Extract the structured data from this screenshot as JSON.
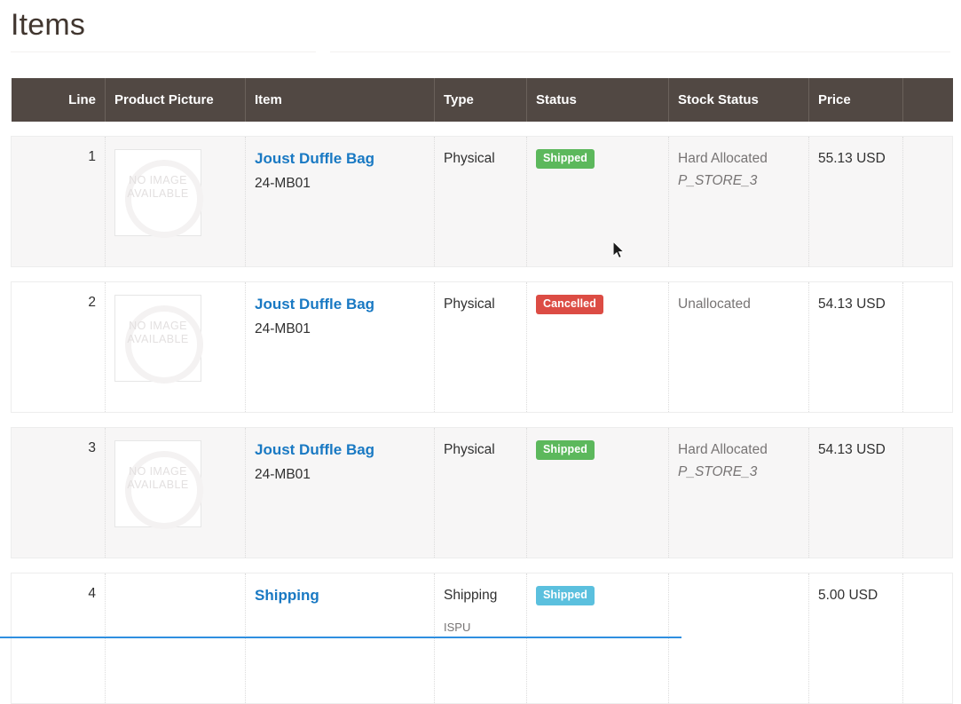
{
  "page": {
    "title": "Items"
  },
  "table": {
    "columns": [
      {
        "key": "line",
        "label": "Line"
      },
      {
        "key": "pic",
        "label": "Product Picture"
      },
      {
        "key": "item",
        "label": "Item"
      },
      {
        "key": "type",
        "label": "Type"
      },
      {
        "key": "status",
        "label": "Status"
      },
      {
        "key": "stock",
        "label": "Stock Status"
      },
      {
        "key": "price",
        "label": "Price"
      },
      {
        "key": "extra",
        "label": ""
      }
    ],
    "placeholder_image_text_line1": "NO IMAGE",
    "placeholder_image_text_line2": "AVAILABLE",
    "rows": [
      {
        "line": "1",
        "has_image": true,
        "item_name": "Joust Duffle Bag",
        "item_sku": "24-MB01",
        "type": "Physical",
        "type_sub": "",
        "status": "Shipped",
        "status_color": "#5cb85c",
        "status_variant": "success",
        "stock": "Hard Allocated",
        "stock_source": "P_STORE_3",
        "price": "55.13 USD"
      },
      {
        "line": "2",
        "has_image": true,
        "item_name": "Joust Duffle Bag",
        "item_sku": "24-MB01",
        "type": "Physical",
        "type_sub": "",
        "status": "Cancelled",
        "status_color": "#dc4c44",
        "status_variant": "danger",
        "stock": "Unallocated",
        "stock_source": "",
        "price": "54.13 USD"
      },
      {
        "line": "3",
        "has_image": true,
        "item_name": "Joust Duffle Bag",
        "item_sku": "24-MB01",
        "type": "Physical",
        "type_sub": "",
        "status": "Shipped",
        "status_color": "#5cb85c",
        "status_variant": "success",
        "stock": "Hard Allocated",
        "stock_source": "P_STORE_3",
        "price": "54.13 USD"
      },
      {
        "line": "4",
        "has_image": false,
        "item_name": "Shipping",
        "item_sku": "",
        "type": "Shipping",
        "type_sub": "ISPU",
        "status": "Shipped",
        "status_color": "#5bc0de",
        "status_variant": "info",
        "stock": "",
        "stock_source": "",
        "price": "5.00 USD"
      }
    ]
  },
  "theme": {
    "header_background": "#514843",
    "link_color": "#1979c3",
    "shaded_row_background": "#f7f6f6",
    "focus_bar_color": "#2f8fe0"
  }
}
